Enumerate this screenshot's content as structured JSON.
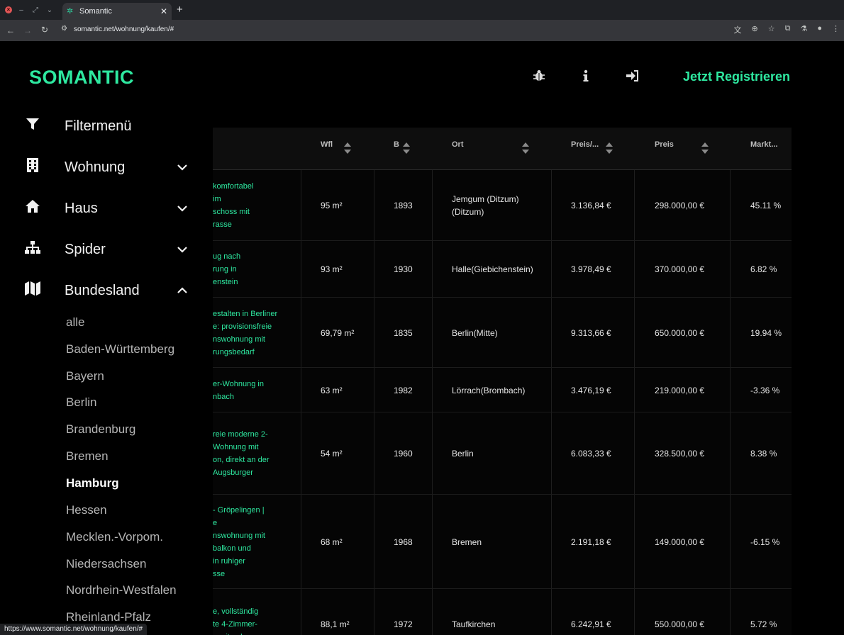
{
  "browser": {
    "tab_title": "Somantic",
    "url": "somantic.net/wohnung/kaufen/#",
    "status_url": "https://www.somantic.net/wohnung/kaufen/#"
  },
  "header": {
    "logo": "SOMANTIC",
    "register_label": "Jetzt Registrieren"
  },
  "sidebar": {
    "filter_label": "Filtermenü",
    "items": [
      {
        "label": "Wohnung",
        "icon": "building-icon",
        "expanded": false
      },
      {
        "label": "Haus",
        "icon": "house-icon",
        "expanded": false
      },
      {
        "label": "Spider",
        "icon": "sitemap-icon",
        "expanded": false
      },
      {
        "label": "Bundesland",
        "icon": "map-icon",
        "expanded": true
      }
    ],
    "states": [
      "alle",
      "Baden-Württemberg",
      "Bayern",
      "Berlin",
      "Brandenburg",
      "Bremen",
      "Hamburg",
      "Hessen",
      "Mecklen.-Vorpom.",
      "Niedersachsen",
      "Nordrhein-Westfalen",
      "Rheinland-Pfalz"
    ],
    "active_state": "Hamburg"
  },
  "table": {
    "headers": [
      "Wfl",
      "B",
      "Ort",
      "Preis/...",
      "Preis",
      "Markt..."
    ],
    "rows": [
      {
        "title": [
          "komfortabel",
          "im",
          "schoss mit",
          "rasse"
        ],
        "wfl": "95 m²",
        "b": "1893",
        "ort": [
          "Jemgum (Ditzum)",
          "(Ditzum)"
        ],
        "ppm": "3.136,84 €",
        "preis": "298.000,00 €",
        "markt": "45.11 %"
      },
      {
        "title": [
          "ug nach",
          "rung in",
          "enstein"
        ],
        "wfl": "93 m²",
        "b": "1930",
        "ort": [
          "Halle(Giebichenstein)"
        ],
        "ppm": "3.978,49 €",
        "preis": "370.000,00 €",
        "markt": "6.82 %"
      },
      {
        "title": [
          "estalten in Berliner",
          "e: provisionsfreie",
          "nswohnung mit",
          "rungsbedarf"
        ],
        "wfl": "69,79 m²",
        "b": "1835",
        "ort": [
          "Berlin(Mitte)"
        ],
        "ppm": "9.313,66 €",
        "preis": "650.000,00 €",
        "markt": "19.94 %"
      },
      {
        "title": [
          "er-Wohnung in",
          "nbach"
        ],
        "wfl": "63 m²",
        "b": "1982",
        "ort": [
          "Lörrach(Brombach)"
        ],
        "ppm": "3.476,19 €",
        "preis": "219.000,00 €",
        "markt": "-3.36 %"
      },
      {
        "title": [
          "reie moderne 2-",
          "Wohnung mit",
          "on, direkt an der",
          "Augsburger"
        ],
        "wfl": "54 m²",
        "b": "1960",
        "ort": [
          "Berlin"
        ],
        "ppm": "6.083,33 €",
        "preis": "328.500,00 €",
        "markt": "8.38 %"
      },
      {
        "title": [
          "- Gröpelingen |",
          "e",
          "nswohnung mit",
          "balkon und",
          "in ruhiger",
          "sse"
        ],
        "wfl": "68 m²",
        "b": "1968",
        "ort": [
          "Bremen"
        ],
        "ppm": "2.191,18 €",
        "preis": "149.000,00 €",
        "markt": "-6.15 %"
      },
      {
        "title": [
          "e, vollständig",
          "te 4-Zimmer-",
          "g mit geh."
        ],
        "wfl": "88,1 m²",
        "b": "1972",
        "ort": [
          "Taufkirchen"
        ],
        "ppm": "6.242,91 €",
        "preis": "550.000,00 €",
        "markt": "5.72 %"
      }
    ]
  },
  "colors": {
    "accent": "#2ee8a0",
    "background": "#000000"
  }
}
